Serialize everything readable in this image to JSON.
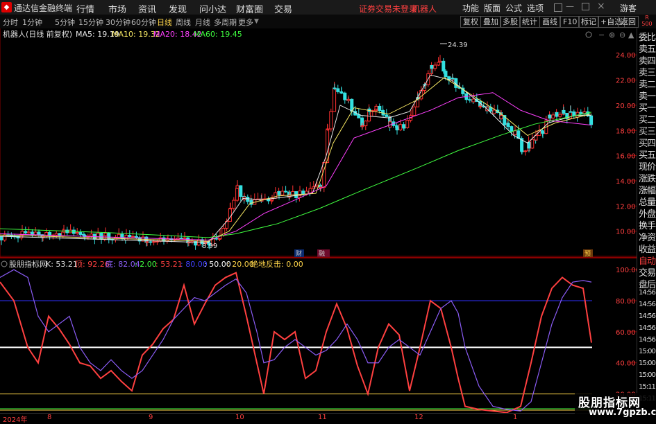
{
  "titlebar": {
    "app_title": "通达信金融终端",
    "menus": [
      "行情",
      "市场",
      "资讯",
      "发现",
      "问小达",
      "财富圈",
      "交易"
    ],
    "warning": "证券交易未登录",
    "robot": "机器人",
    "right_menus": [
      "功能",
      "版面",
      "公式",
      "选项"
    ],
    "user": "游客"
  },
  "toolbar": {
    "periods": [
      "分时",
      "1分钟",
      "5分钟",
      "15分钟",
      "30分钟",
      "60分钟",
      "日线",
      "周线",
      "月线",
      "多周期",
      "更多"
    ],
    "active_period": "日线",
    "right_buttons": [
      "复权",
      "叠加",
      "多股",
      "统计",
      "画线",
      "F10",
      "标记",
      "+自选",
      "返回"
    ],
    "corner_r": "R",
    "corner_num": "500"
  },
  "main_chart": {
    "legend_title": "机器人(日线 前复权)",
    "ma_labels": [
      "MA5: 19.19",
      "MA10: 19.32",
      "MA20: 18.42",
      "MA60: 19.45"
    ],
    "ma_colors": [
      "#e8e8e8",
      "#f5e663",
      "#ff40ff",
      "#40ff40"
    ],
    "high_label": "24.39",
    "low_label": "8.99",
    "markers": [
      "财",
      "融",
      "预"
    ],
    "y_ticks": [
      "24.00",
      "22.00",
      "20.00",
      "18.00",
      "16.00",
      "14.00",
      "12.00",
      "10.00"
    ]
  },
  "sub_chart": {
    "name": "股朋指标网",
    "values": [
      {
        "label": "K: 53.21",
        "color": "#dddddd"
      },
      {
        "label": "顶: 92.26",
        "color": "#ff4040"
      },
      {
        "label": "底: 82.04",
        "color": "#8b5cf6"
      },
      {
        "label": ": 2.00",
        "color": "#40ff40"
      },
      {
        "label": ": 53.21",
        "color": "#ff4040"
      },
      {
        "label": ": 80.00",
        "color": "#4040ff"
      },
      {
        "label": ": 50.00",
        "color": "#ffffff"
      },
      {
        "label": ": 20.00",
        "color": "#ffd54a"
      },
      {
        "label": "绝地反击: 0.00",
        "color": "#ffd54a"
      }
    ],
    "y_ticks": [
      "100.00",
      "80.00",
      "60.00",
      "40.00",
      "20.00"
    ]
  },
  "right_panel": {
    "items": [
      "委比",
      "卖五",
      "卖四",
      "卖三",
      "卖二",
      "卖一",
      "买一",
      "买二",
      "买三",
      "买四",
      "买五",
      "现价",
      "涨跌",
      "涨幅",
      "总量",
      "外盘",
      "换手",
      "净资",
      "收益",
      "自动",
      "交易",
      "盘后",
      "14:56",
      "14:56",
      "14:56",
      "14:56",
      "14:56",
      "15:00",
      "15:00",
      "15:00",
      "15:11",
      "15:11"
    ]
  },
  "time_axis": {
    "labels": [
      "2024年",
      "8",
      "9",
      "10",
      "11",
      "12",
      "1"
    ]
  },
  "watermark": {
    "line1": "股朋指标网",
    "line2": "www.7gpzb.com"
  },
  "chart_data": [
    {
      "type": "candlestick",
      "title": "机器人(日线 前复权)",
      "ylim": [
        8.5,
        25.0
      ],
      "close_points": [
        [
          0,
          9.6
        ],
        [
          30,
          9.7
        ],
        [
          60,
          9.8
        ],
        [
          90,
          9.9
        ],
        [
          120,
          9.7
        ],
        [
          150,
          9.6
        ],
        [
          180,
          9.4
        ],
        [
          210,
          9.3
        ],
        [
          240,
          9.3
        ],
        [
          270,
          9.2
        ],
        [
          300,
          9.1
        ],
        [
          315,
          9.4
        ],
        [
          330,
          11.6
        ],
        [
          340,
          13.4
        ],
        [
          350,
          12.6
        ],
        [
          360,
          12.2
        ],
        [
          375,
          12.3
        ],
        [
          390,
          12.6
        ],
        [
          400,
          13.1
        ],
        [
          415,
          12.8
        ],
        [
          430,
          13.0
        ],
        [
          445,
          13.1
        ],
        [
          460,
          13.6
        ],
        [
          470,
          18.0
        ],
        [
          480,
          21.2
        ],
        [
          490,
          20.8
        ],
        [
          500,
          20.4
        ],
        [
          510,
          19.0
        ],
        [
          520,
          18.4
        ],
        [
          530,
          19.6
        ],
        [
          540,
          20.0
        ],
        [
          550,
          19.2
        ],
        [
          560,
          18.4
        ],
        [
          570,
          18.3
        ],
        [
          580,
          18.3
        ],
        [
          590,
          19.0
        ],
        [
          600,
          20.4
        ],
        [
          610,
          21.8
        ],
        [
          620,
          23.2
        ],
        [
          632,
          23.2
        ],
        [
          640,
          22.4
        ],
        [
          650,
          22.0
        ],
        [
          660,
          21.2
        ],
        [
          670,
          20.6
        ],
        [
          680,
          20.2
        ],
        [
          690,
          19.9
        ],
        [
          700,
          19.6
        ],
        [
          710,
          19.4
        ],
        [
          720,
          19.0
        ],
        [
          730,
          18.4
        ],
        [
          740,
          17.8
        ],
        [
          750,
          16.4
        ],
        [
          760,
          16.8
        ],
        [
          770,
          17.4
        ],
        [
          780,
          18.0
        ],
        [
          790,
          19.2
        ],
        [
          800,
          19.4
        ],
        [
          810,
          19.3
        ],
        [
          820,
          19.2
        ],
        [
          830,
          19.3
        ],
        [
          840,
          19.4
        ],
        [
          852,
          18.4
        ]
      ],
      "series": [
        {
          "name": "MA5",
          "values": [
            [
              0,
              9.6
            ],
            [
              300,
              9.1
            ],
            [
              330,
              11.0
            ],
            [
              350,
              12.6
            ],
            [
              380,
              12.5
            ],
            [
              450,
              13.0
            ],
            [
              470,
              16.0
            ],
            [
              490,
              20.0
            ],
            [
              520,
              19.2
            ],
            [
              560,
              19.0
            ],
            [
              590,
              19.5
            ],
            [
              620,
              22.4
            ],
            [
              650,
              22.0
            ],
            [
              700,
              19.8
            ],
            [
              740,
              17.6
            ],
            [
              760,
              17.0
            ],
            [
              790,
              18.6
            ],
            [
              830,
              19.2
            ],
            [
              852,
              19.19
            ]
          ]
        },
        {
          "name": "MA10",
          "values": [
            [
              0,
              9.7
            ],
            [
              300,
              9.2
            ],
            [
              330,
              10.0
            ],
            [
              360,
              12.2
            ],
            [
              400,
              12.8
            ],
            [
              455,
              13.0
            ],
            [
              480,
              17.0
            ],
            [
              510,
              19.8
            ],
            [
              560,
              19.3
            ],
            [
              600,
              20.4
            ],
            [
              640,
              22.2
            ],
            [
              680,
              20.8
            ],
            [
              720,
              19.4
            ],
            [
              760,
              17.6
            ],
            [
              800,
              18.6
            ],
            [
              852,
              19.32
            ]
          ]
        },
        {
          "name": "MA20",
          "values": [
            [
              0,
              9.8
            ],
            [
              300,
              9.3
            ],
            [
              340,
              10.0
            ],
            [
              380,
              11.4
            ],
            [
              430,
              12.6
            ],
            [
              470,
              13.6
            ],
            [
              510,
              17.4
            ],
            [
              560,
              18.4
            ],
            [
              620,
              19.6
            ],
            [
              660,
              20.6
            ],
            [
              710,
              21.0
            ],
            [
              750,
              19.6
            ],
            [
              790,
              18.8
            ],
            [
              852,
              18.42
            ]
          ]
        },
        {
          "name": "MA60",
          "values": [
            [
              0,
              10.2
            ],
            [
              150,
              9.9
            ],
            [
              300,
              9.5
            ],
            [
              340,
              9.8
            ],
            [
              400,
              10.6
            ],
            [
              460,
              11.8
            ],
            [
              520,
              13.2
            ],
            [
              600,
              15.0
            ],
            [
              660,
              16.4
            ],
            [
              720,
              17.6
            ],
            [
              770,
              18.5
            ],
            [
              852,
              19.45
            ]
          ]
        }
      ]
    },
    {
      "type": "line",
      "title": "股朋指标网",
      "ylim": [
        10,
        105
      ],
      "series": [
        {
          "name": "顶",
          "color": "#ff4040",
          "values": [
            [
              0,
              92
            ],
            [
              20,
              80
            ],
            [
              40,
              50
            ],
            [
              55,
              40
            ],
            [
              70,
              70
            ],
            [
              85,
              62
            ],
            [
              100,
              52
            ],
            [
              115,
              40
            ],
            [
              130,
              38
            ],
            [
              145,
              30
            ],
            [
              160,
              35
            ],
            [
              175,
              28
            ],
            [
              190,
              22
            ],
            [
              205,
              45
            ],
            [
              220,
              52
            ],
            [
              235,
              62
            ],
            [
              250,
              68
            ],
            [
              265,
              90
            ],
            [
              280,
              65
            ],
            [
              295,
              78
            ],
            [
              310,
              90
            ],
            [
              325,
              95
            ],
            [
              340,
              98
            ],
            [
              355,
              70
            ],
            [
              370,
              40
            ],
            [
              380,
              20
            ],
            [
              395,
              60
            ],
            [
              410,
              55
            ],
            [
              425,
              60
            ],
            [
              440,
              30
            ],
            [
              455,
              35
            ],
            [
              470,
              60
            ],
            [
              485,
              78
            ],
            [
              500,
              62
            ],
            [
              515,
              38
            ],
            [
              530,
              20
            ],
            [
              545,
              50
            ],
            [
              560,
              65
            ],
            [
              575,
              58
            ],
            [
              590,
              22
            ],
            [
              605,
              50
            ],
            [
              620,
              80
            ],
            [
              635,
              75
            ],
            [
              650,
              50
            ],
            [
              660,
              30
            ],
            [
              670,
              12
            ],
            [
              690,
              10
            ],
            [
              710,
              9
            ],
            [
              730,
              8
            ],
            [
              750,
              12
            ],
            [
              765,
              40
            ],
            [
              780,
              70
            ],
            [
              795,
              88
            ],
            [
              810,
              95
            ],
            [
              825,
              90
            ],
            [
              840,
              88
            ],
            [
              852,
              53
            ]
          ]
        },
        {
          "name": "底",
          "color": "#8b5cf6",
          "values": [
            [
              0,
              95
            ],
            [
              20,
              100
            ],
            [
              40,
              95
            ],
            [
              55,
              70
            ],
            [
              70,
              60
            ],
            [
              85,
              65
            ],
            [
              100,
              70
            ],
            [
              115,
              50
            ],
            [
              130,
              40
            ],
            [
              145,
              35
            ],
            [
              160,
              42
            ],
            [
              175,
              35
            ],
            [
              190,
              30
            ],
            [
              205,
              35
            ],
            [
              220,
              45
            ],
            [
              235,
              55
            ],
            [
              250,
              68
            ],
            [
              265,
              75
            ],
            [
              280,
              82
            ],
            [
              295,
              80
            ],
            [
              310,
              85
            ],
            [
              325,
              90
            ],
            [
              340,
              94
            ],
            [
              355,
              85
            ],
            [
              370,
              60
            ],
            [
              380,
              40
            ],
            [
              395,
              42
            ],
            [
              410,
              50
            ],
            [
              425,
              55
            ],
            [
              440,
              50
            ],
            [
              455,
              45
            ],
            [
              470,
              48
            ],
            [
              485,
              55
            ],
            [
              500,
              65
            ],
            [
              515,
              55
            ],
            [
              530,
              40
            ],
            [
              545,
              40
            ],
            [
              560,
              50
            ],
            [
              575,
              55
            ],
            [
              590,
              50
            ],
            [
              605,
              45
            ],
            [
              620,
              60
            ],
            [
              635,
              75
            ],
            [
              650,
              80
            ],
            [
              660,
              72
            ],
            [
              670,
              50
            ],
            [
              690,
              25
            ],
            [
              710,
              12
            ],
            [
              730,
              10
            ],
            [
              750,
              9
            ],
            [
              765,
              15
            ],
            [
              780,
              40
            ],
            [
              795,
              65
            ],
            [
              810,
              82
            ],
            [
              825,
              92
            ],
            [
              840,
              93
            ],
            [
              852,
              92
            ]
          ]
        }
      ],
      "reference_lines": [
        {
          "name": "80.00",
          "value": 80
        },
        {
          "name": "50.00",
          "value": 50
        },
        {
          "name": "20.00",
          "value": 20
        }
      ]
    }
  ]
}
